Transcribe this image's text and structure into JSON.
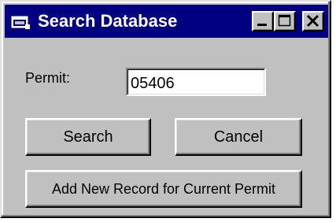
{
  "window": {
    "title": "Search Database",
    "icon": "app-window-icon",
    "controls": {
      "minimize_icon": "minimize-icon",
      "maximize_icon": "maximize-icon",
      "close_icon": "close-icon"
    },
    "colors": {
      "titlebar": "#000080",
      "face": "#c0c0c0"
    }
  },
  "form": {
    "permit_label": "Permit:",
    "permit_value": "05406"
  },
  "buttons": {
    "search": "Search",
    "cancel": "Cancel",
    "add_new": "Add New Record for Current Permit"
  }
}
